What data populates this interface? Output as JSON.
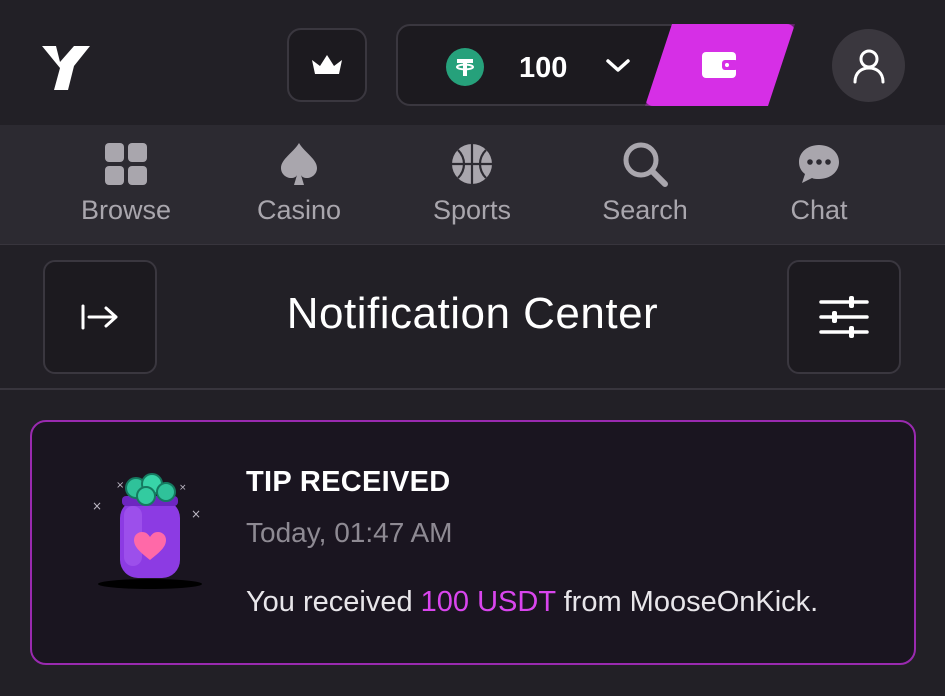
{
  "header": {
    "balance": "100",
    "currency_icon": "usdt-icon",
    "accent_color": "#d62fe6"
  },
  "nav": {
    "items": [
      {
        "label": "Browse",
        "icon": "grid-icon"
      },
      {
        "label": "Casino",
        "icon": "spade-icon"
      },
      {
        "label": "Sports",
        "icon": "basketball-icon"
      },
      {
        "label": "Search",
        "icon": "search-icon"
      },
      {
        "label": "Chat",
        "icon": "chat-icon"
      }
    ]
  },
  "notification_center": {
    "title": "Notification Center"
  },
  "notification": {
    "title": "TIP RECEIVED",
    "time": "Today, 01:47 AM",
    "message_prefix": "You received ",
    "amount": "100 USDT",
    "message_suffix": " from MooseOnKick.",
    "amount_color": "#d945ee",
    "border_color": "#9a2ab0"
  }
}
